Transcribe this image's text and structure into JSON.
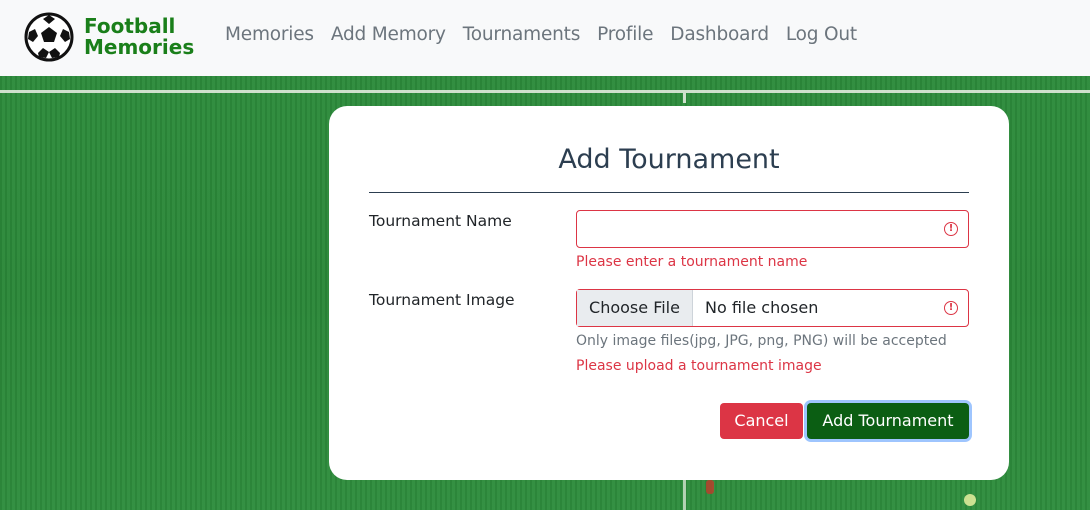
{
  "brand": {
    "line1": "Football",
    "line2": "Memories",
    "logo": "soccer-ball-logo"
  },
  "nav": {
    "items": [
      "Memories",
      "Add Memory",
      "Tournaments",
      "Profile",
      "Dashboard",
      "Log Out"
    ]
  },
  "form": {
    "title": "Add Tournament",
    "name_label": "Tournament Name",
    "name_value": "",
    "name_error": "Please enter a tournament name",
    "image_label": "Tournament Image",
    "choose_file_label": "Choose File",
    "file_status": "No file chosen",
    "image_help": "Only image files(jpg, JPG, png, PNG) will be accepted",
    "image_error": "Please upload a tournament image",
    "warning_icon": "exclamation-circle-icon",
    "cancel_label": "Cancel",
    "submit_label": "Add Tournament"
  },
  "colors": {
    "error": "#dc3545",
    "submit": "#0b5e13",
    "brand": "#1a7f1a",
    "title": "#2c3e50"
  }
}
